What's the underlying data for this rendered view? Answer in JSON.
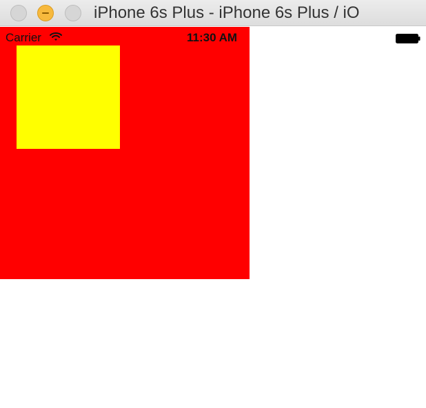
{
  "window": {
    "title": "iPhone 6s Plus - iPhone 6s Plus / iO"
  },
  "status_bar": {
    "carrier": "Carrier",
    "time": "11:30 AM",
    "wifi_icon": "wifi-icon",
    "battery_icon": "battery-icon"
  },
  "colors": {
    "red_view": "#ff0000",
    "yellow_view": "#ffff00",
    "minimize_button": "#f7b93d"
  }
}
